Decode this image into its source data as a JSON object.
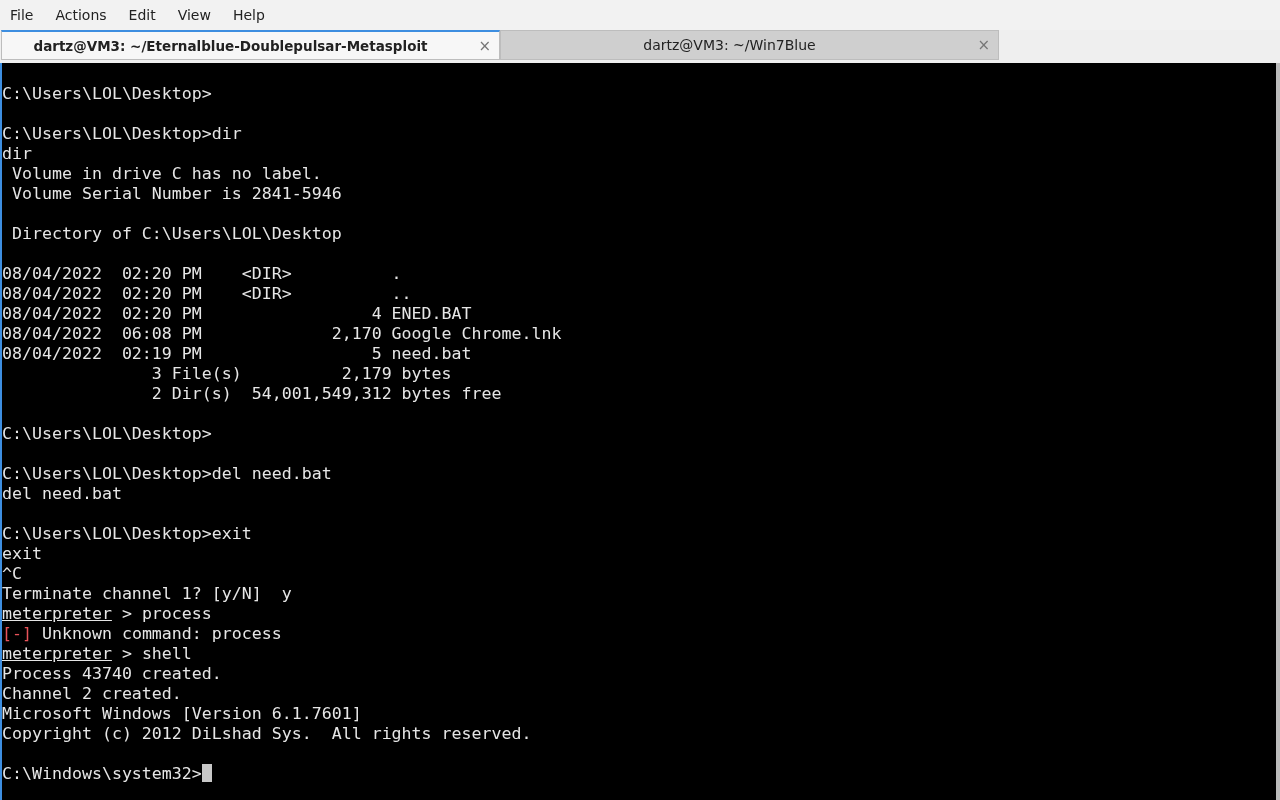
{
  "menu": [
    "File",
    "Actions",
    "Edit",
    "View",
    "Help"
  ],
  "tabs": [
    {
      "title": "dartz@VM3: ~/Eternalblue-Doublepulsar-Metasploit",
      "close": "×",
      "selected": true
    },
    {
      "title": "dartz@VM3: ~/Win7Blue",
      "close": "×",
      "selected": false
    }
  ],
  "terminal": {
    "lines": [
      {
        "kind": "blank"
      },
      {
        "kind": "plain",
        "text": "C:\\Users\\LOL\\Desktop>"
      },
      {
        "kind": "blank"
      },
      {
        "kind": "plain",
        "text": "C:\\Users\\LOL\\Desktop>dir"
      },
      {
        "kind": "plain",
        "text": "dir"
      },
      {
        "kind": "plain",
        "text": " Volume in drive C has no label."
      },
      {
        "kind": "plain",
        "text": " Volume Serial Number is 2841-5946"
      },
      {
        "kind": "blank"
      },
      {
        "kind": "plain",
        "text": " Directory of C:\\Users\\LOL\\Desktop"
      },
      {
        "kind": "blank"
      },
      {
        "kind": "plain",
        "text": "08/04/2022  02:20 PM    <DIR>          ."
      },
      {
        "kind": "plain",
        "text": "08/04/2022  02:20 PM    <DIR>          .."
      },
      {
        "kind": "plain",
        "text": "08/04/2022  02:20 PM                 4 ENED.BAT"
      },
      {
        "kind": "plain",
        "text": "08/04/2022  06:08 PM             2,170 Google Chrome.lnk"
      },
      {
        "kind": "plain",
        "text": "08/04/2022  02:19 PM                 5 need.bat"
      },
      {
        "kind": "plain",
        "text": "               3 File(s)          2,179 bytes"
      },
      {
        "kind": "plain",
        "text": "               2 Dir(s)  54,001,549,312 bytes free"
      },
      {
        "kind": "blank"
      },
      {
        "kind": "plain",
        "text": "C:\\Users\\LOL\\Desktop>"
      },
      {
        "kind": "blank"
      },
      {
        "kind": "plain",
        "text": "C:\\Users\\LOL\\Desktop>del need.bat"
      },
      {
        "kind": "plain",
        "text": "del need.bat"
      },
      {
        "kind": "blank"
      },
      {
        "kind": "plain",
        "text": "C:\\Users\\LOL\\Desktop>exit"
      },
      {
        "kind": "plain",
        "text": "exit"
      },
      {
        "kind": "plain",
        "text": "^C"
      },
      {
        "kind": "plain",
        "text": "Terminate channel 1? [y/N]  y"
      },
      {
        "kind": "prompt",
        "prompt": "meterpreter",
        "text": " > process"
      },
      {
        "kind": "error",
        "marker": "[-]",
        "text": " Unknown command: process"
      },
      {
        "kind": "prompt",
        "prompt": "meterpreter",
        "text": " > shell"
      },
      {
        "kind": "plain",
        "text": "Process 43740 created."
      },
      {
        "kind": "plain",
        "text": "Channel 2 created."
      },
      {
        "kind": "plain",
        "text": "Microsoft Windows [Version 6.1.7601]"
      },
      {
        "kind": "plain",
        "text": "Copyright (c) 2012 DiLshad Sys.  All rights reserved."
      },
      {
        "kind": "blank"
      },
      {
        "kind": "input",
        "text": "C:\\Windows\\system32>"
      }
    ]
  }
}
